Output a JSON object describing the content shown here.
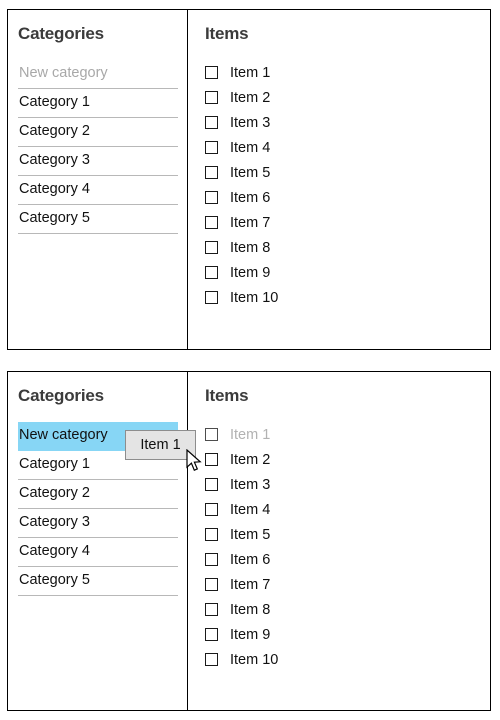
{
  "views": [
    {
      "id": "initial-state",
      "categories_panel": {
        "title": "Categories",
        "rows": [
          {
            "label": "New category",
            "state": "placeholder"
          },
          {
            "label": "Category 1",
            "state": "normal"
          },
          {
            "label": "Category 2",
            "state": "normal"
          },
          {
            "label": "Category 3",
            "state": "normal"
          },
          {
            "label": "Category 4",
            "state": "normal"
          },
          {
            "label": "Category 5",
            "state": "normal"
          }
        ]
      },
      "items_panel": {
        "title": "Items",
        "rows": [
          {
            "label": "Item 1",
            "checked": false,
            "state": "normal"
          },
          {
            "label": "Item 2",
            "checked": false,
            "state": "normal"
          },
          {
            "label": "Item 3",
            "checked": false,
            "state": "normal"
          },
          {
            "label": "Item 4",
            "checked": false,
            "state": "normal"
          },
          {
            "label": "Item 5",
            "checked": false,
            "state": "normal"
          },
          {
            "label": "Item 6",
            "checked": false,
            "state": "normal"
          },
          {
            "label": "Item 7",
            "checked": false,
            "state": "normal"
          },
          {
            "label": "Item 8",
            "checked": false,
            "state": "normal"
          },
          {
            "label": "Item 9",
            "checked": false,
            "state": "normal"
          },
          {
            "label": "Item 10",
            "checked": false,
            "state": "normal"
          }
        ]
      }
    },
    {
      "id": "drag-state",
      "categories_panel": {
        "title": "Categories",
        "rows": [
          {
            "label": "New category",
            "state": "droptarget"
          },
          {
            "label": "Category 1",
            "state": "normal"
          },
          {
            "label": "Category 2",
            "state": "normal"
          },
          {
            "label": "Category 3",
            "state": "normal"
          },
          {
            "label": "Category 4",
            "state": "normal"
          },
          {
            "label": "Category 5",
            "state": "normal"
          }
        ]
      },
      "items_panel": {
        "title": "Items",
        "rows": [
          {
            "label": "Item 1",
            "checked": false,
            "state": "dragging"
          },
          {
            "label": "Item 2",
            "checked": false,
            "state": "normal"
          },
          {
            "label": "Item 3",
            "checked": false,
            "state": "normal"
          },
          {
            "label": "Item 4",
            "checked": false,
            "state": "normal"
          },
          {
            "label": "Item 5",
            "checked": false,
            "state": "normal"
          },
          {
            "label": "Item 6",
            "checked": false,
            "state": "normal"
          },
          {
            "label": "Item 7",
            "checked": false,
            "state": "normal"
          },
          {
            "label": "Item 8",
            "checked": false,
            "state": "normal"
          },
          {
            "label": "Item 9",
            "checked": false,
            "state": "normal"
          },
          {
            "label": "Item 10",
            "checked": false,
            "state": "normal"
          }
        ]
      },
      "drag_ghost": {
        "label": "Item 1"
      },
      "cursor": {
        "icon": "arrow-pointer-icon"
      }
    }
  ],
  "colors": {
    "drop_target_highlight": "#87d6f5",
    "drag_ghost_background": "#e4e4e4",
    "drag_ghost_border": "#8d8d8d",
    "placeholder_text": "#a8a8a8",
    "heading_text": "#3b3b3b",
    "body_text": "#111111",
    "panel_border": "#000000",
    "row_divider": "#b8b8b8",
    "dragging_text": "#b2b2b2"
  }
}
